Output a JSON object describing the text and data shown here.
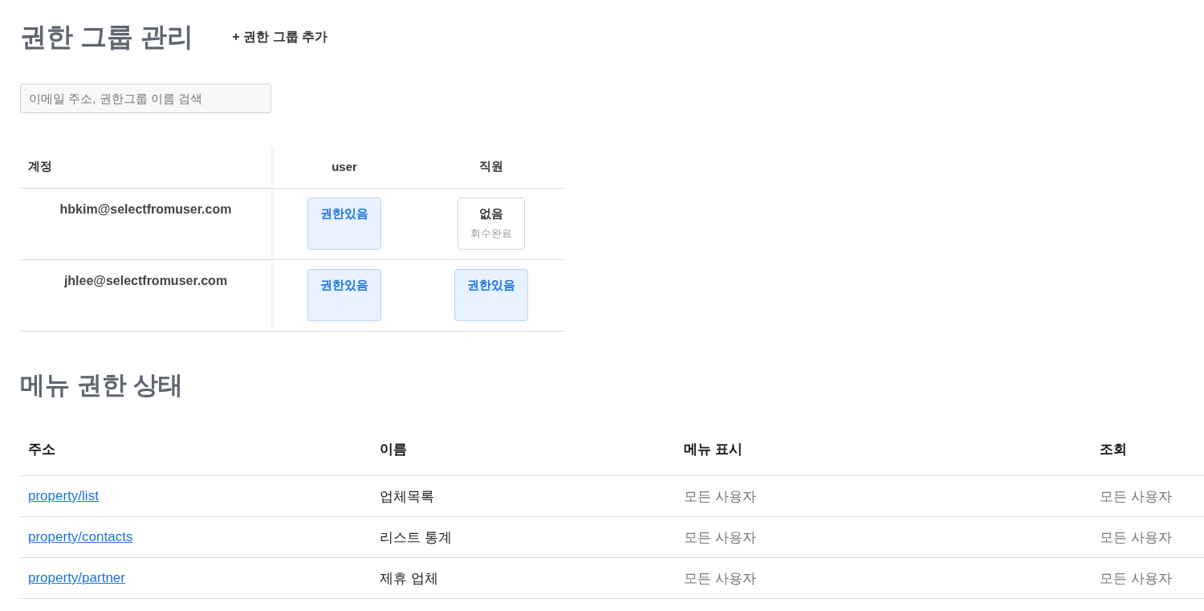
{
  "header": {
    "title": "권한 그룹 관리",
    "add_button": "+ 권한 그룹 추가"
  },
  "search": {
    "placeholder": "이메일 주소, 권한그룹 이름 검색"
  },
  "group_table": {
    "columns": [
      "계정",
      "user",
      "직원"
    ],
    "rows": [
      {
        "cells": [
          {
            "kind": "account",
            "label": "hbkim@selectfromuser.com"
          },
          {
            "kind": "permission",
            "granted": true,
            "label": "권한있음"
          },
          {
            "kind": "permission",
            "granted": false,
            "label": "없음",
            "sublabel": "회수완료"
          }
        ]
      },
      {
        "cells": [
          {
            "kind": "account",
            "label": "jhlee@selectfromuser.com"
          },
          {
            "kind": "permission",
            "granted": true,
            "label": "권한있음"
          },
          {
            "kind": "permission",
            "granted": true,
            "label": "권한있음"
          }
        ]
      }
    ]
  },
  "menu_section": {
    "title": "메뉴 권한 상태",
    "columns": [
      "주소",
      "이름",
      "메뉴 표시",
      "조회"
    ],
    "rows": [
      {
        "path": "property/list",
        "name": "업체목록",
        "menu_display": "모든 사용자",
        "view": "모든 사용자"
      },
      {
        "path": "property/contacts",
        "name": "리스트 통계",
        "menu_display": "모든 사용자",
        "view": "모든 사용자"
      },
      {
        "path": "property/partner",
        "name": "제휴 업체",
        "menu_display": "모든 사용자",
        "view": "모든 사용자"
      }
    ]
  }
}
